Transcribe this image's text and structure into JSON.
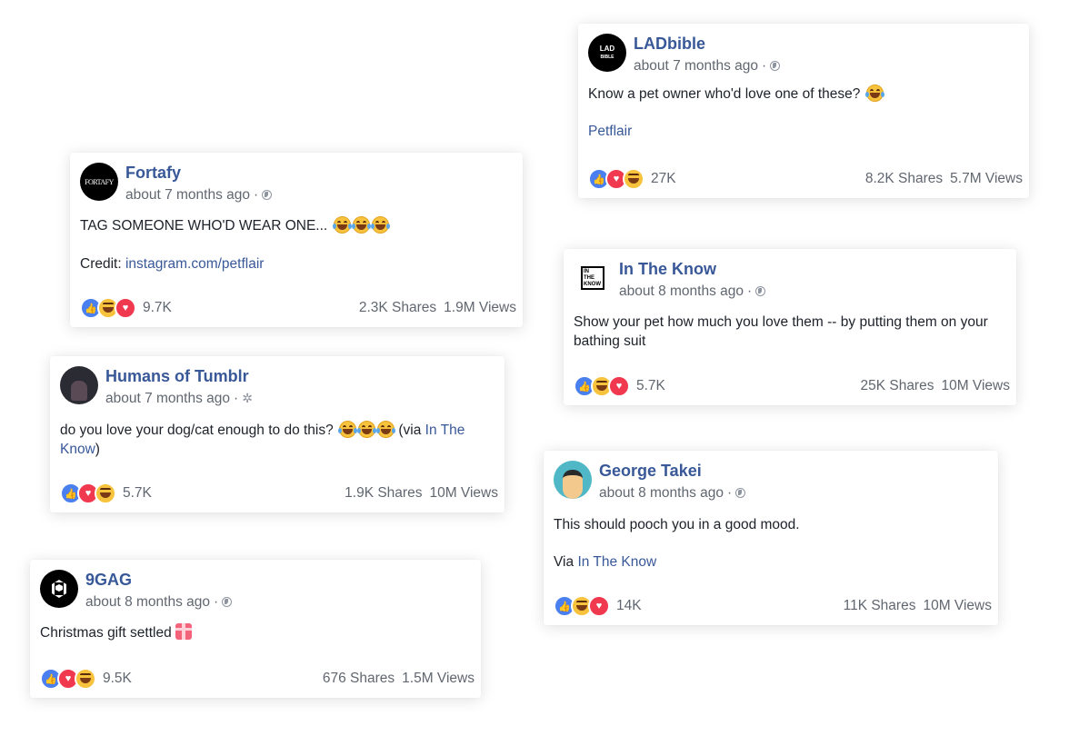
{
  "posts": [
    {
      "page": "LADbible",
      "time": "about 7 months ago",
      "text": "Know a pet owner who'd love one of these? ",
      "link": "Petflair",
      "reactions_count": "27K",
      "shares": "8.2K Shares",
      "views": "5.7M Views",
      "avatar_label": "LAD BIBLE"
    },
    {
      "page": "Fortafy",
      "time": "about 7 months ago",
      "text": "TAG SOMEONE WHO'D WEAR ONE... ",
      "credit_prefix": "Credit: ",
      "credit_link": "instagram.com/petflair",
      "reactions_count": "9.7K",
      "shares": "2.3K Shares",
      "views": "1.9M Views",
      "avatar_label": "FORTAFY"
    },
    {
      "page": "In The Know",
      "time": "about 8 months ago",
      "text": "Show your pet how much you love them -- by putting them on your bathing suit",
      "reactions_count": "5.7K",
      "shares": "25K Shares",
      "views": "10M Views",
      "avatar_label": "IN THE KNOW"
    },
    {
      "page": "Humans of Tumblr",
      "time": "about 7 months ago",
      "text": "do you love your dog/cat enough to do this? ",
      "text_via_prefix": " (via ",
      "text_via_link": "In The Know",
      "text_via_suffix": ")",
      "reactions_count": "5.7K",
      "shares": "1.9K Shares",
      "views": "10M Views"
    },
    {
      "page": "George Takei",
      "time": "about 8 months ago",
      "text": "This should pooch you in a good mood.",
      "via_prefix": "Via ",
      "via_link": "In The Know",
      "reactions_count": "14K",
      "shares": "11K Shares",
      "views": "10M Views"
    },
    {
      "page": "9GAG",
      "time": "about 8 months ago",
      "text": "Christmas gift settled",
      "reactions_count": "9.5K",
      "shares": "676 Shares",
      "views": "1.5M Views"
    }
  ],
  "icons": {
    "globe": "globe-icon",
    "gear": "gear-icon",
    "like": "like-reaction-icon",
    "love": "love-reaction-icon",
    "haha": "haha-reaction-icon"
  },
  "colors": {
    "link": "#385898",
    "meta": "#616770",
    "like": "#4a7ff0",
    "love": "#f0384f",
    "haha": "#f7c23c"
  }
}
